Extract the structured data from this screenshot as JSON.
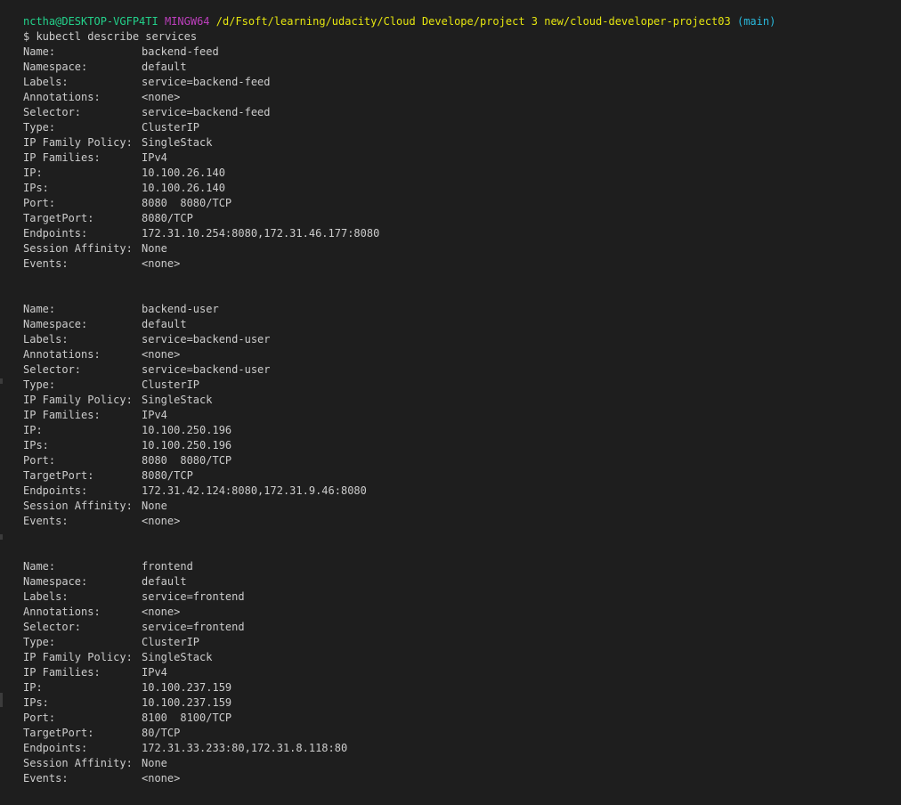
{
  "prompt": {
    "user_host": "nctha@DESKTOP-VGFP4TI",
    "shell": "MINGW64",
    "path": "/d/Fsoft/learning/udacity/Cloud Develope/project 3 new/cloud-developer-project03",
    "branch": "(main)"
  },
  "command": "$ kubectl describe services",
  "services": [
    {
      "fields": [
        {
          "key": "Name:",
          "value": "backend-feed"
        },
        {
          "key": "Namespace:",
          "value": "default"
        },
        {
          "key": "Labels:",
          "value": "service=backend-feed"
        },
        {
          "key": "Annotations:",
          "value": "<none>"
        },
        {
          "key": "Selector:",
          "value": "service=backend-feed"
        },
        {
          "key": "Type:",
          "value": "ClusterIP"
        },
        {
          "key": "IP Family Policy:",
          "value": "SingleStack"
        },
        {
          "key": "IP Families:",
          "value": "IPv4"
        },
        {
          "key": "IP:",
          "value": "10.100.26.140"
        },
        {
          "key": "IPs:",
          "value": "10.100.26.140"
        },
        {
          "key": "Port:",
          "value": "8080  8080/TCP"
        },
        {
          "key": "TargetPort:",
          "value": "8080/TCP"
        },
        {
          "key": "Endpoints:",
          "value": "172.31.10.254:8080,172.31.46.177:8080"
        },
        {
          "key": "Session Affinity:",
          "value": "None"
        },
        {
          "key": "Events:",
          "value": "<none>"
        }
      ]
    },
    {
      "fields": [
        {
          "key": "Name:",
          "value": "backend-user"
        },
        {
          "key": "Namespace:",
          "value": "default"
        },
        {
          "key": "Labels:",
          "value": "service=backend-user"
        },
        {
          "key": "Annotations:",
          "value": "<none>"
        },
        {
          "key": "Selector:",
          "value": "service=backend-user"
        },
        {
          "key": "Type:",
          "value": "ClusterIP"
        },
        {
          "key": "IP Family Policy:",
          "value": "SingleStack"
        },
        {
          "key": "IP Families:",
          "value": "IPv4"
        },
        {
          "key": "IP:",
          "value": "10.100.250.196"
        },
        {
          "key": "IPs:",
          "value": "10.100.250.196"
        },
        {
          "key": "Port:",
          "value": "8080  8080/TCP"
        },
        {
          "key": "TargetPort:",
          "value": "8080/TCP"
        },
        {
          "key": "Endpoints:",
          "value": "172.31.42.124:8080,172.31.9.46:8080"
        },
        {
          "key": "Session Affinity:",
          "value": "None"
        },
        {
          "key": "Events:",
          "value": "<none>"
        }
      ]
    },
    {
      "fields": [
        {
          "key": "Name:",
          "value": "frontend"
        },
        {
          "key": "Namespace:",
          "value": "default"
        },
        {
          "key": "Labels:",
          "value": "service=frontend"
        },
        {
          "key": "Annotations:",
          "value": "<none>"
        },
        {
          "key": "Selector:",
          "value": "service=frontend"
        },
        {
          "key": "Type:",
          "value": "ClusterIP"
        },
        {
          "key": "IP Family Policy:",
          "value": "SingleStack"
        },
        {
          "key": "IP Families:",
          "value": "IPv4"
        },
        {
          "key": "IP:",
          "value": "10.100.237.159"
        },
        {
          "key": "IPs:",
          "value": "10.100.237.159"
        },
        {
          "key": "Port:",
          "value": "8100  8100/TCP"
        },
        {
          "key": "TargetPort:",
          "value": "80/TCP"
        },
        {
          "key": "Endpoints:",
          "value": "172.31.33.233:80,172.31.8.118:80"
        },
        {
          "key": "Session Affinity:",
          "value": "None"
        },
        {
          "key": "Events:",
          "value": "<none>"
        }
      ]
    }
  ],
  "colors": {
    "background": "#1e1e1e",
    "text": "#cccccc",
    "user_host": "#23d18b",
    "shell": "#bc3fbc",
    "path": "#e5e510",
    "branch": "#29b8db"
  }
}
